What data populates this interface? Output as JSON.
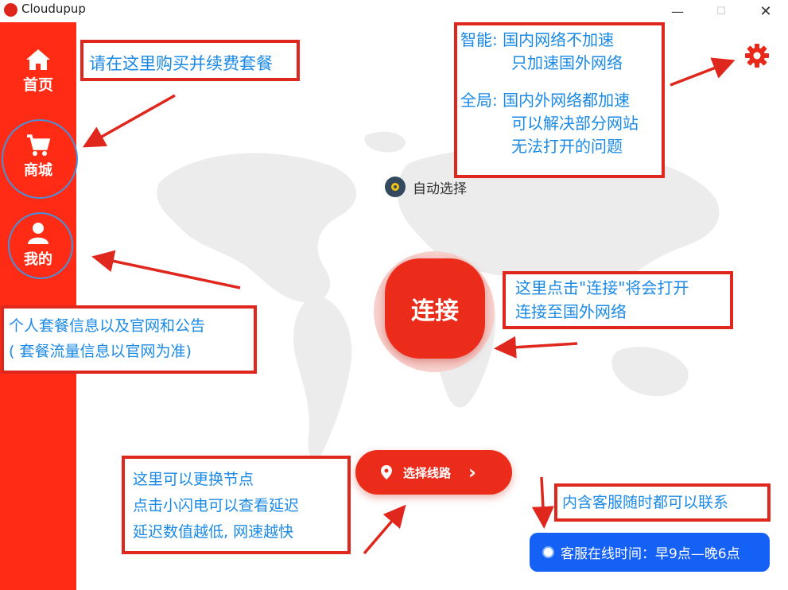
{
  "app": {
    "title": "Cloudupup"
  },
  "window_controls": {
    "minimize": "—",
    "maximize": "☐",
    "close": "✕"
  },
  "sidebar": {
    "items": [
      {
        "label": "首页",
        "icon": "home-icon"
      },
      {
        "label": "商城",
        "icon": "cart-icon"
      },
      {
        "label": "我的",
        "icon": "user-icon"
      }
    ]
  },
  "main": {
    "mode_label": "自动选择",
    "connect_label": "连接",
    "route_label": "选择线路",
    "route_chevron": "›",
    "support_hours": "客服在线时间：早9点—晚6点"
  },
  "annotations": {
    "shop": [
      "请在这里购买并续费套餐"
    ],
    "settings": [
      "智能: 国内网络不加速",
      "只加速国外网络",
      "全局: 国内外网络都加速",
      "可以解决部分网站",
      "无法打开的问题"
    ],
    "profile": [
      "个人套餐信息以及官网和公告",
      "( 套餐流量信息以官网为准)"
    ],
    "connect": [
      "这里点击\"连接\"将会打开",
      "连接至国外网络"
    ],
    "route": [
      "这里可以更换节点",
      "点击小闪电可以查看延迟",
      "延迟数值越低, 网速越快"
    ],
    "support": [
      "内含客服随时都可以联系"
    ]
  },
  "colors": {
    "sidebar": "#ff2b14",
    "accent": "#ec2c1b",
    "annotation_border": "#e0271d",
    "annotation_text": "#1b8ae6",
    "support_pill": "#1561f5"
  }
}
